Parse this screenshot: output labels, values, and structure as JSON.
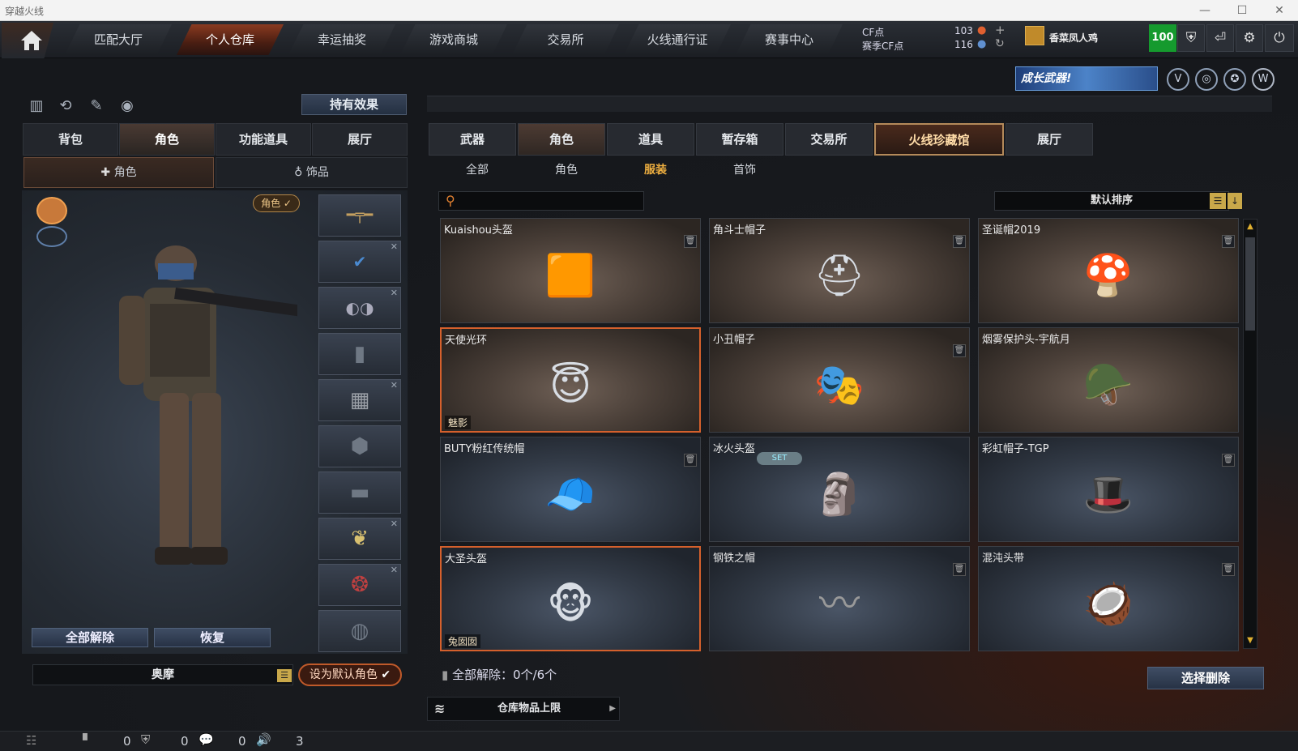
{
  "window": {
    "title": "穿越火线",
    "min": "—",
    "max": "☐",
    "close": "✕"
  },
  "nav": {
    "home_icon": "home-icon",
    "tabs": [
      {
        "label": "匹配大厅",
        "active": false
      },
      {
        "label": "个人仓库",
        "active": true
      },
      {
        "label": "幸运抽奖",
        "active": false
      },
      {
        "label": "游戏商城",
        "active": false
      },
      {
        "label": "交易所",
        "active": false
      },
      {
        "label": "火线通行证",
        "active": false
      },
      {
        "label": "赛事中心",
        "active": false
      }
    ],
    "cf_label": "CF点",
    "season_cf_label": "赛季CF点",
    "cf_value": "103",
    "season_cf_value": "116",
    "player_name": "香菜凤人鸡",
    "level_badge": "100"
  },
  "banner": {
    "boost_text": "成长武器!"
  },
  "left": {
    "effects_button": "持有效果",
    "tabs": [
      "背包",
      "角色",
      "功能道具",
      "展厅"
    ],
    "subtabs": [
      "角色",
      "饰品"
    ],
    "role_badge": "角色 ✓",
    "unequip_all": "全部解除",
    "restore": "恢复",
    "role_name": "奥摩",
    "set_default": "设为默认角色"
  },
  "right": {
    "tabs": [
      "武器",
      "角色",
      "道具",
      "暂存箱",
      "交易所",
      "火线珍藏馆",
      "展厅"
    ],
    "subtabs": [
      "全部",
      "角色",
      "服装",
      "首饰"
    ],
    "search_placeholder": "",
    "sort_label": "默认排序",
    "items": [
      {
        "name": "Kuaishou头盔",
        "tag": "",
        "set": "",
        "icon": "🟧"
      },
      {
        "name": "角斗士帽子",
        "tag": "",
        "set": "",
        "icon": "⛑"
      },
      {
        "name": "圣诞帽2019",
        "tag": "",
        "set": "",
        "icon": "🍄"
      },
      {
        "name": "天使光环",
        "tag": "魅影",
        "set": "",
        "icon": "😇"
      },
      {
        "name": "小丑帽子",
        "tag": "",
        "set": "",
        "icon": "🎭"
      },
      {
        "name": "烟雾保护头-宇航月",
        "tag": "",
        "set": "",
        "icon": "🪖"
      },
      {
        "name": "BUTY粉红传统帽",
        "tag": "",
        "set": "",
        "icon": "🧢"
      },
      {
        "name": "冰火头盔",
        "tag": "",
        "set": "SET",
        "icon": "🗿"
      },
      {
        "name": "彩虹帽子-TGP",
        "tag": "",
        "set": "",
        "icon": "🎩"
      },
      {
        "name": "大圣头盔",
        "tag": "兔囡囡",
        "set": "",
        "icon": "🐵"
      },
      {
        "name": "钢铁之帽",
        "tag": "",
        "set": "",
        "icon": "〰"
      },
      {
        "name": "混沌头带",
        "tag": "",
        "set": "",
        "icon": "🥥"
      }
    ],
    "unequip_all_text": "全部解除：0个/6个",
    "select_delete": "选择删除",
    "capacity_limit": "仓库物品上限"
  },
  "status": {
    "count1": "0",
    "count2": "0",
    "count3": "0",
    "count4": "3"
  }
}
